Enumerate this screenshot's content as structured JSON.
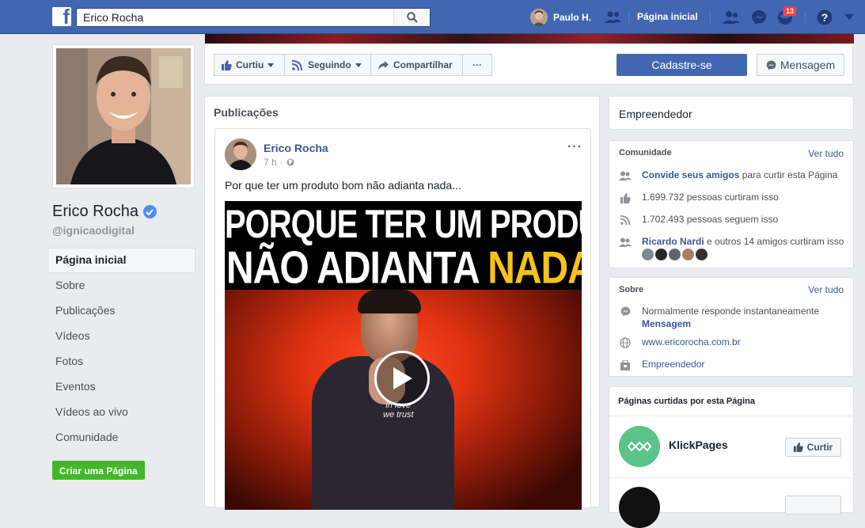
{
  "topbar": {
    "search_value": "Erico Rocha",
    "user_name": "Paulo H.",
    "home_label": "Página inicial",
    "notifications_count": "13"
  },
  "profile": {
    "name": "Erico Rocha",
    "handle": "@ignicaodigital"
  },
  "left_nav": {
    "items": [
      {
        "label": "Página inicial",
        "active": true
      },
      {
        "label": "Sobre"
      },
      {
        "label": "Publicações"
      },
      {
        "label": "Vídeos"
      },
      {
        "label": "Fotos"
      },
      {
        "label": "Eventos"
      },
      {
        "label": "Vídeos ao vivo"
      },
      {
        "label": "Comunidade"
      }
    ],
    "create_page_label": "Criar uma Página"
  },
  "action_bar": {
    "like_label": "Curtiu",
    "follow_label": "Seguindo",
    "share_label": "Compartilhar",
    "more_label": "···",
    "signup_label": "Cadastre-se",
    "message_label": "Mensagem"
  },
  "publications": {
    "title": "Publicações",
    "post": {
      "author": "Erico Rocha",
      "time": "7 h ·",
      "text": "Por que ter um produto bom não adianta nada...",
      "video_line1": "PORQUE TER UM PRODUTO BOM",
      "video_line2_white": "NÃO ADIANTA ",
      "video_line2_yellow": "NADA",
      "tee_text": "in love\nwe trust"
    }
  },
  "right": {
    "category": "Empreendedor",
    "community": {
      "title": "Comunidade",
      "see_all": "Ver tudo",
      "invite_link": "Convide seus amigos",
      "invite_rest": " para curtir esta Página",
      "likes": "1.699.732 pessoas curtiram isso",
      "follows": "1.702.493 pessoas seguem isso",
      "friend_name": "Ricardo Nardi",
      "friend_rest": " e outros 14 amigos curtiram isso"
    },
    "about": {
      "title": "Sobre",
      "see_all": "Ver tudo",
      "response": "Normalmente responde instantaneamente",
      "message_link": "Mensagem",
      "website": "www.ericorocha.com.br",
      "category": "Empreendedor"
    },
    "liked_pages": {
      "title": "Páginas curtidas por esta Página",
      "page_name": "KlickPages",
      "like_button": "Curtir"
    }
  },
  "colors": {
    "brand_blue": "#4267b2",
    "link_blue": "#385898",
    "green": "#42b72a",
    "yellow": "#f7c21b"
  }
}
